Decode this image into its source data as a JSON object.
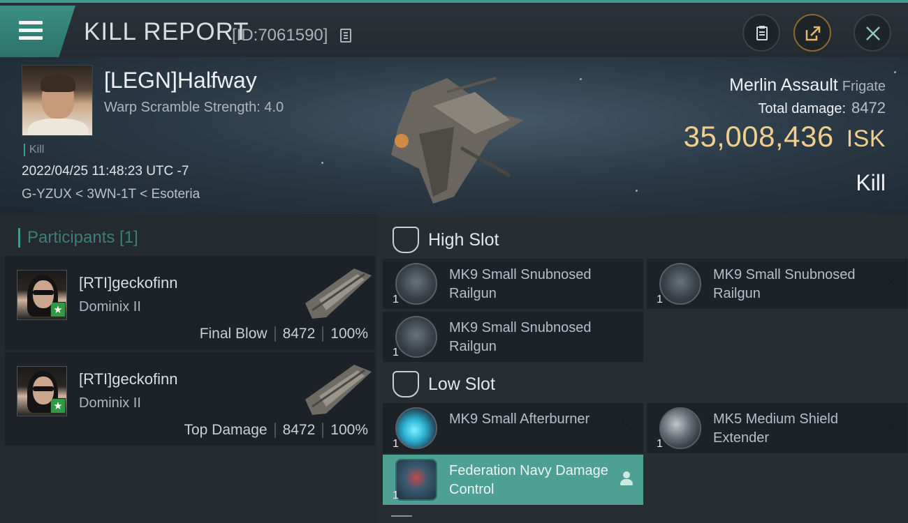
{
  "header": {
    "title": "KILL REPORT",
    "report_id": "[ID:7061590]",
    "icons": [
      "menu-icon",
      "copy-icon",
      "clipboard-icon",
      "share-icon",
      "close-icon"
    ]
  },
  "victim": {
    "pilot": "[LEGN]Halfway",
    "subtitle": "Warp Scramble Strength: 4.0",
    "tag": "Kill",
    "datetime": "2022/04/25 11:48:23 UTC -7",
    "location": "G-YZUX < 3WN-1T < Esoteria",
    "ship": "Merlin Assault",
    "ship_class": "Frigate",
    "total_damage_label": "Total damage:",
    "total_damage": "8472",
    "isk_value": "35,008,436",
    "isk_unit": "ISK",
    "result": "Kill"
  },
  "participants": {
    "header": "Participants [1]",
    "items": [
      {
        "name": "[RTI]geckofinn",
        "ship": "Dominix II",
        "role": "Final Blow",
        "damage": "8472",
        "percent": "100%"
      },
      {
        "name": "[RTI]geckofinn",
        "ship": "Dominix II",
        "role": "Top Damage",
        "damage": "8472",
        "percent": "100%"
      }
    ]
  },
  "fitting": {
    "high_slot": {
      "label": "High Slot",
      "modules": [
        {
          "name": "MK9 Small Snubnosed Railgun",
          "qty": "1"
        },
        {
          "name": "MK9 Small Snubnosed Railgun",
          "qty": "1"
        },
        {
          "name": "MK9 Small Snubnosed Railgun",
          "qty": "1"
        }
      ]
    },
    "low_slot": {
      "label": "Low Slot",
      "modules": [
        {
          "name": "MK9 Small Afterburner",
          "qty": "1"
        },
        {
          "name": "MK5 Medium Shield Extender",
          "qty": "1"
        },
        {
          "name": "Federation Navy Damage Control",
          "qty": "1"
        }
      ]
    }
  },
  "colors": {
    "accent": "#3f9c8e",
    "isk": "#f0cf8e",
    "selected_module": "#4e9f94",
    "badge": "#2f9a45"
  }
}
